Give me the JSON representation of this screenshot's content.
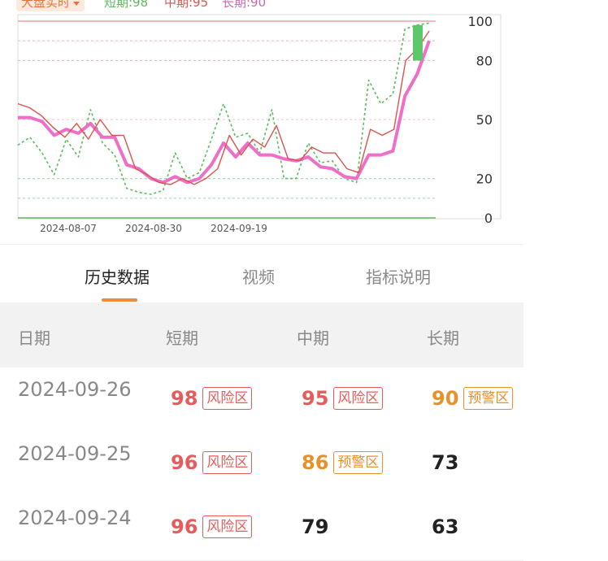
{
  "selector": {
    "label": "大盘实时"
  },
  "legend": {
    "short": "短期:98",
    "mid": "中期:95",
    "long": "长期:90"
  },
  "colors": {
    "short": "#5cb85c",
    "mid": "#d9534f",
    "long": "#ee6fc7",
    "accent": "#e8743b"
  },
  "chart_data": {
    "type": "line",
    "x_tick_labels": [
      "2024-08-07",
      "2024-08-30",
      "2024-09-19"
    ],
    "y_ticks": [
      100,
      80,
      50,
      20,
      0
    ],
    "ylim": [
      0,
      100
    ],
    "series": [
      {
        "name": "短期",
        "style": "dotted",
        "values": [
          37,
          41,
          33,
          22,
          40,
          31,
          55,
          38,
          32,
          15,
          13,
          12,
          14,
          33,
          20,
          23,
          40,
          58,
          41,
          43,
          33,
          55,
          20,
          20,
          38,
          28,
          29,
          20,
          18,
          70,
          58,
          63,
          96,
          98,
          99
        ]
      },
      {
        "name": "中期",
        "style": "solid",
        "values": [
          58,
          56,
          52,
          46,
          41,
          48,
          40,
          50,
          42,
          42,
          25,
          22,
          18,
          17,
          20,
          17,
          20,
          25,
          42,
          32,
          40,
          36,
          47,
          30,
          29,
          36,
          33,
          33,
          25,
          23,
          45,
          42,
          45,
          80,
          86,
          95
        ]
      },
      {
        "name": "长期",
        "style": "thick",
        "values": [
          51,
          51,
          49,
          42,
          45,
          43,
          48,
          41,
          41,
          27,
          25,
          20,
          18,
          21,
          18,
          20,
          27,
          38,
          31,
          38,
          32,
          32,
          30,
          29,
          31,
          26,
          25,
          21,
          20,
          32,
          32,
          34,
          62,
          73,
          90
        ]
      }
    ]
  },
  "tabs": [
    {
      "label": "历史数据",
      "active": true
    },
    {
      "label": "视频",
      "active": false
    },
    {
      "label": "指标说明",
      "active": false
    }
  ],
  "table": {
    "headers": [
      "日期",
      "短期",
      "中期",
      "长期"
    ],
    "rows": [
      {
        "date": "2024-09-26",
        "short": {
          "value": "98",
          "badge": "风险区"
        },
        "mid": {
          "value": "95",
          "badge": "风险区"
        },
        "long": {
          "value": "90",
          "badge": "预警区"
        }
      },
      {
        "date": "2024-09-25",
        "short": {
          "value": "96",
          "badge": "风险区"
        },
        "mid": {
          "value": "86",
          "badge": "预警区"
        },
        "long": {
          "value": "73",
          "badge": ""
        }
      },
      {
        "date": "2024-09-24",
        "short": {
          "value": "96",
          "badge": "风险区"
        },
        "mid": {
          "value": "79",
          "badge": ""
        },
        "long": {
          "value": "63",
          "badge": ""
        }
      }
    ]
  }
}
